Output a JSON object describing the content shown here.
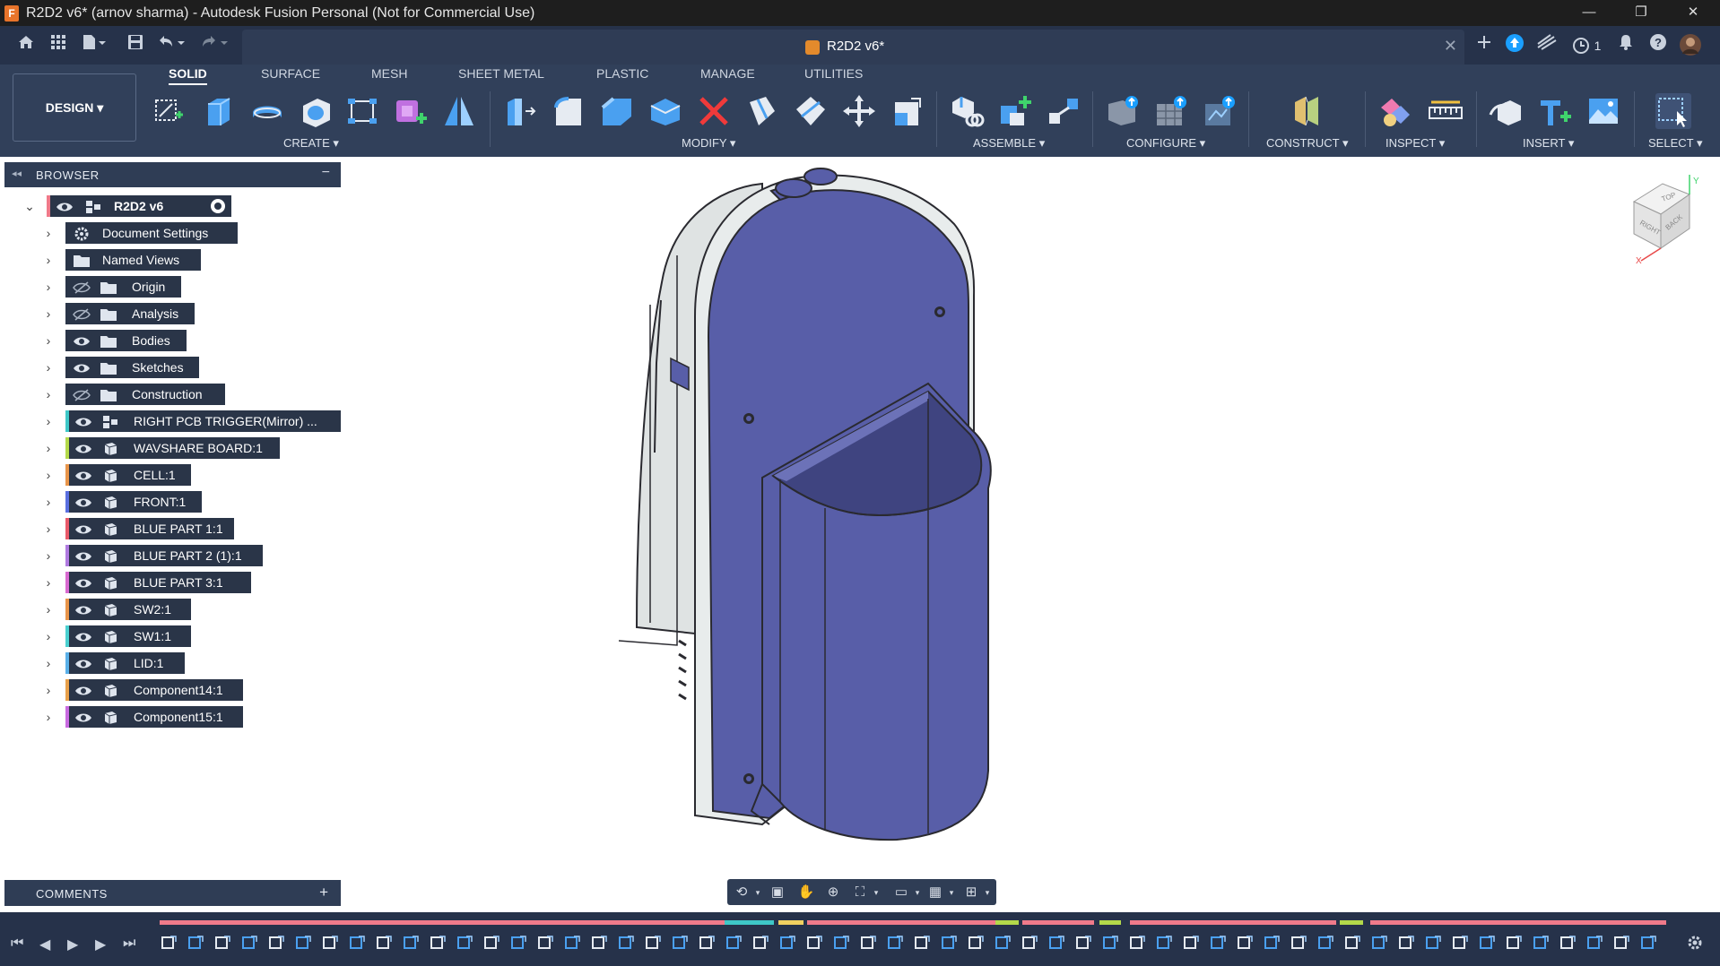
{
  "window": {
    "title": "R2D2 v6* (arnov sharma) - Autodesk Fusion Personal (Not for Commercial Use)",
    "app_icon": "F",
    "minimize": "—",
    "restore": "❐",
    "close": "✕"
  },
  "doc_tab": {
    "title": "R2D2 v6*",
    "close": "✕"
  },
  "quick_bar": {
    "jobs_count": "1"
  },
  "toolbar": {
    "workspace": "DESIGN ▾",
    "tabs": [
      "SOLID",
      "SURFACE",
      "MESH",
      "SHEET METAL",
      "PLASTIC",
      "MANAGE",
      "UTILITIES"
    ],
    "active_tab": "SOLID",
    "groups": {
      "create": "CREATE ▾",
      "modify": "MODIFY ▾",
      "assemble": "ASSEMBLE ▾",
      "configure": "CONFIGURE ▾",
      "construct": "CONSTRUCT ▾",
      "inspect": "INSPECT ▾",
      "insert": "INSERT ▾",
      "select": "SELECT ▾"
    }
  },
  "browser": {
    "header": "BROWSER",
    "root": "R2D2 v6",
    "items": [
      {
        "label": "Document Settings",
        "icon": "gear-icon",
        "eye": "none",
        "color": ""
      },
      {
        "label": "Named Views",
        "icon": "folder-icon",
        "eye": "none",
        "color": ""
      },
      {
        "label": "Origin",
        "icon": "folder-icon",
        "eye": "hidden",
        "color": ""
      },
      {
        "label": "Analysis",
        "icon": "folder-icon",
        "eye": "hidden",
        "color": ""
      },
      {
        "label": "Bodies",
        "icon": "folder-icon",
        "eye": "visible",
        "color": ""
      },
      {
        "label": "Sketches",
        "icon": "folder-icon",
        "eye": "visible",
        "color": ""
      },
      {
        "label": "Construction",
        "icon": "folder-icon",
        "eye": "hidden",
        "color": ""
      },
      {
        "label": "RIGHT PCB TRIGGER(Mirror) ...",
        "icon": "component-icon",
        "eye": "visible",
        "color": "#3ec7c7"
      },
      {
        "label": "WAVSHARE BOARD:1",
        "icon": "component-icon",
        "eye": "visible",
        "color": "#b3d94a"
      },
      {
        "label": "CELL:1",
        "icon": "component-icon",
        "eye": "visible",
        "color": "#e8954a"
      },
      {
        "label": "FRONT:1",
        "icon": "component-icon",
        "eye": "visible",
        "color": "#5a6fe0"
      },
      {
        "label": "BLUE PART 1:1",
        "icon": "component-icon",
        "eye": "visible",
        "color": "#e85a6a"
      },
      {
        "label": "BLUE PART 2 (1):1",
        "icon": "component-icon",
        "eye": "visible",
        "color": "#b07ae0"
      },
      {
        "label": "BLUE PART 3:1",
        "icon": "component-icon",
        "eye": "visible",
        "color": "#d86ad0"
      },
      {
        "label": "SW2:1",
        "icon": "component-icon",
        "eye": "visible",
        "color": "#e8954a"
      },
      {
        "label": "SW1:1",
        "icon": "component-icon",
        "eye": "visible",
        "color": "#4ad0d0"
      },
      {
        "label": "LID:1",
        "icon": "component-icon",
        "eye": "visible",
        "color": "#5ab0e8"
      },
      {
        "label": "Component14:1",
        "icon": "component-icon",
        "eye": "visible",
        "color": "#e8a04a"
      },
      {
        "label": "Component15:1",
        "icon": "component-icon",
        "eye": "visible",
        "color": "#c86ae0"
      }
    ]
  },
  "comments": {
    "header": "COMMENTS",
    "add": "+"
  },
  "viewcube": {
    "top": "TOP",
    "right": "RIGHT",
    "back": "BACK",
    "axis_x": "X",
    "axis_y": "Y"
  },
  "colors": {
    "accent": "#1a9fff",
    "model_blue": "#585ea8",
    "model_gray": "#dde2e2"
  }
}
